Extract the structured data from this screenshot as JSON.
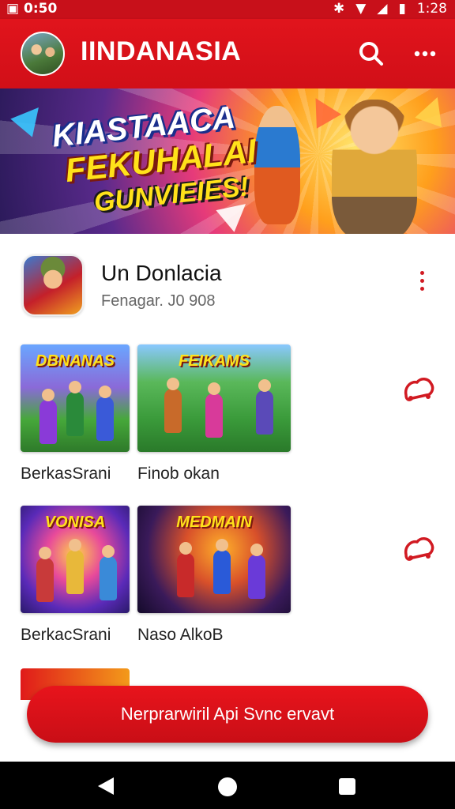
{
  "status_bar": {
    "left_text": "0:50",
    "time": "1:28",
    "icons": [
      "sim-icon",
      "bluetooth-icon",
      "wifi-icon",
      "signal-icon",
      "battery-icon"
    ]
  },
  "app_bar": {
    "title": "IINDANASIA",
    "icons": [
      "avatar",
      "search-icon",
      "more-vert-icon"
    ]
  },
  "banner": {
    "line1": "KIASTAACA",
    "line2": "FEKUHALAI",
    "line3": "GUNVIEIES!"
  },
  "section": {
    "title": "Un Donlacia",
    "subtitle": "Fenagar. J0 908",
    "icons": [
      "more-vert-icon"
    ]
  },
  "games": [
    {
      "logo": "DBNANAS",
      "title": "BerkasSrani"
    },
    {
      "logo": "FEIKAMS",
      "title": "Finob okan"
    },
    {
      "logo": "VONISA",
      "title": "BerkacSrani"
    },
    {
      "logo": "MEDMAIN",
      "title": "Naso AlkoB"
    }
  ],
  "row_actions": [
    "game-controller-icon",
    "game-controller-icon"
  ],
  "fab": {
    "label": "Nerprarwiril Api Svnc ervavt"
  },
  "nav_bar": {
    "icons": [
      "back-icon",
      "home-icon",
      "recents-icon"
    ]
  },
  "colors": {
    "primary": "#d10f18",
    "accent_red": "#d11a22",
    "text_dark": "#111111",
    "text_muted": "#666666",
    "nav_bg": "#000000"
  }
}
